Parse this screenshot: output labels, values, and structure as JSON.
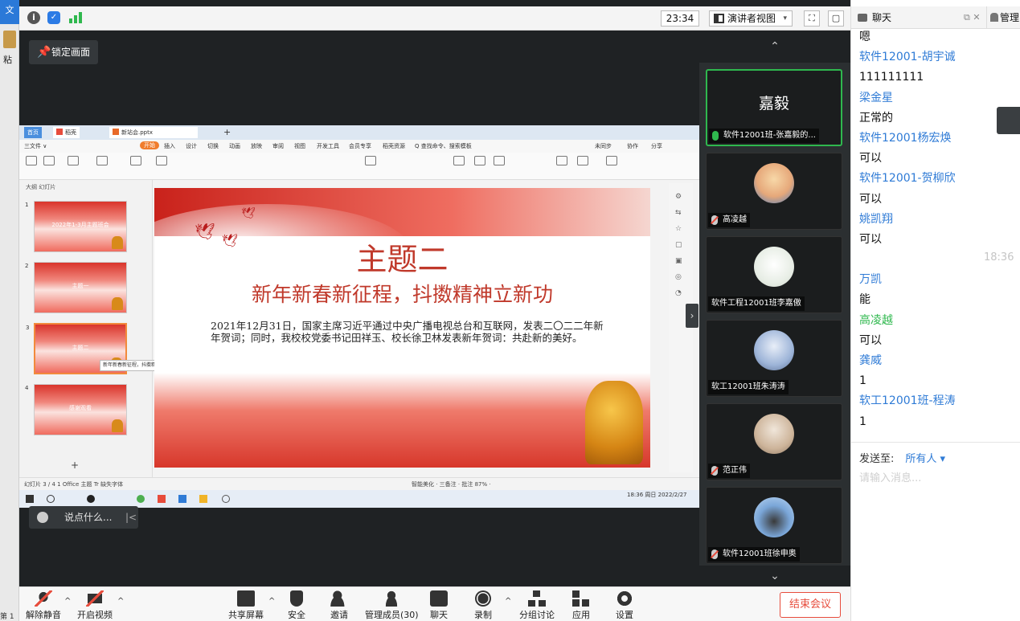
{
  "bg_app": {
    "tab": "文",
    "paste": "粘",
    "page": "第 1"
  },
  "topbar": {
    "time": "23:34",
    "view_label": "演讲者视图",
    "caret": "▾",
    "fullscreen": "⛶",
    "layout": "▢"
  },
  "lock_button": "锁定画面",
  "share": {
    "tabs": {
      "home": "首页",
      "shell": "稻壳",
      "file": "新站会.pptx",
      "plus": "+"
    },
    "menu": [
      "三文件 ∨",
      "开始",
      "插入",
      "设计",
      "切换",
      "动画",
      "放映",
      "审阅",
      "视图",
      "开发工具",
      "会员专享",
      "稻壳资源",
      "Q 查找命令、搜索模板",
      "未同步",
      "协作",
      "分享"
    ],
    "thumb_header": "大纲  幻灯片",
    "thumbs": [
      {
        "num": "1",
        "text": "2022年1-3月主题班会"
      },
      {
        "num": "2",
        "text": "主题一"
      },
      {
        "num": "3",
        "text": "主题二"
      },
      {
        "num": "4",
        "text": "感谢观看"
      }
    ],
    "tooltip": "新年新春新征程，抖擞精神…",
    "slide": {
      "title": "主题二",
      "subtitle": "新年新春新征程，抖擞精神立新功",
      "body": "2021年12月31日，国家主席习近平通过中央广播电视总台和互联网，发表二〇二二年新年贺词；同时，我校校党委书记田祥玉、校长徐卫林发表新年贺词：共赴新的美好。"
    },
    "status": {
      "left": "幻灯片 3 / 4   1 Office 主题   Tr 缺失字体",
      "right": "智能美化 · 三备注 · 批注   87% ·"
    },
    "taskbar_clock": "18:36 周日\n2022/2/27"
  },
  "say_box": "说点什么...",
  "participants": [
    {
      "name": "软件12001班-张嘉毅的...",
      "big": "嘉毅",
      "active": true,
      "mic": "on"
    },
    {
      "name": "高凌越",
      "mic": "off"
    },
    {
      "name": "软件工程12001班李嘉傲",
      "mic": "none"
    },
    {
      "name": "软工12001班朱涛涛",
      "mic": "none"
    },
    {
      "name": "范正伟",
      "mic": "off"
    },
    {
      "name": "软件12001班徐申奥",
      "mic": "off"
    }
  ],
  "toolbar": {
    "unmute": "解除静音",
    "start_video": "开启视频",
    "share_screen": "共享屏幕",
    "security": "安全",
    "invite": "邀请",
    "manage": "管理成员(30)",
    "chat": "聊天",
    "record": "录制",
    "breakout": "分组讨论",
    "apps": "应用",
    "settings": "设置",
    "end": "结束会议"
  },
  "chat": {
    "title": "聊天",
    "manage": "管理",
    "messages": [
      {
        "t": "嗯",
        "type": "text"
      },
      {
        "t": "软件12001-胡宇诚",
        "type": "name"
      },
      {
        "t": "111111111",
        "type": "text"
      },
      {
        "t": "梁金星",
        "type": "name"
      },
      {
        "t": "正常的",
        "type": "text"
      },
      {
        "t": "软件12001杨宏焕",
        "type": "name"
      },
      {
        "t": "可以",
        "type": "text"
      },
      {
        "t": "软件12001-贺柳欣",
        "type": "name"
      },
      {
        "t": "可以",
        "type": "text"
      },
      {
        "t": "姚凯翔",
        "type": "name"
      },
      {
        "t": "可以",
        "type": "text"
      },
      {
        "t": "",
        "type": "gap"
      },
      {
        "t": "万凯",
        "type": "name"
      },
      {
        "t": "能",
        "type": "text"
      },
      {
        "t": "高凌越",
        "type": "name-green"
      },
      {
        "t": "可以",
        "type": "text"
      },
      {
        "t": "龚威",
        "type": "name"
      },
      {
        "t": "1",
        "type": "text"
      },
      {
        "t": "软工12001班-程涛",
        "type": "name"
      },
      {
        "t": "1",
        "type": "text"
      }
    ],
    "timestamp": "18:36",
    "send_to_label": "发送至:",
    "send_to_value": "所有人 ▾",
    "input_placeholder": "请输入消息..."
  },
  "colors": {
    "accent_blue": "#2f7bd6",
    "accent_green": "#2fb84e",
    "end_red": "#e74c3c",
    "slide_red": "#c0392b"
  }
}
